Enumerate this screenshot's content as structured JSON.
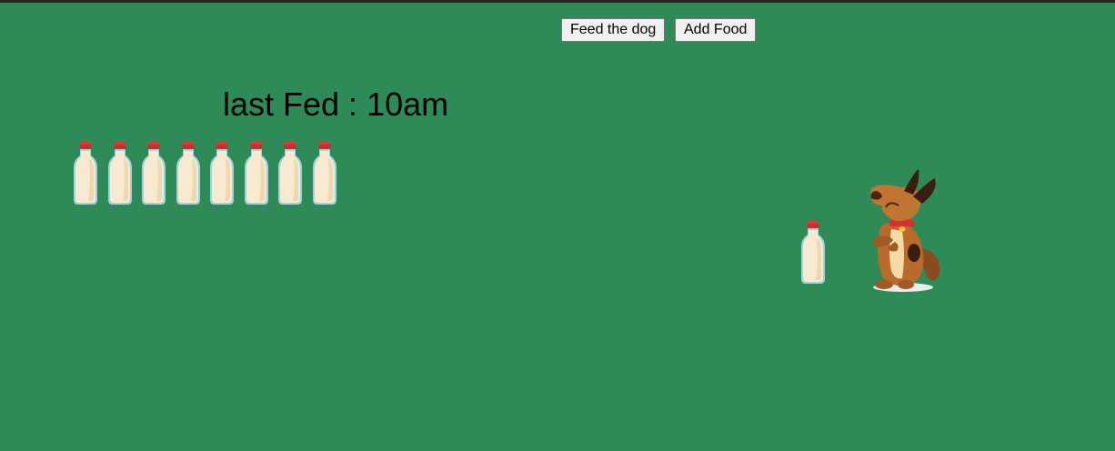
{
  "toolbar": {
    "feed_label": "Feed the dog",
    "add_label": "Add Food"
  },
  "status": {
    "last_fed_text": "last Fed : 10am"
  },
  "food_stock": {
    "bottle_count": 8,
    "icon": "milk-bottle-icon"
  },
  "scene": {
    "background_color": "#2e8b57",
    "dog_icon": "dog-icon",
    "bottle_near_dog_icon": "milk-bottle-icon"
  }
}
